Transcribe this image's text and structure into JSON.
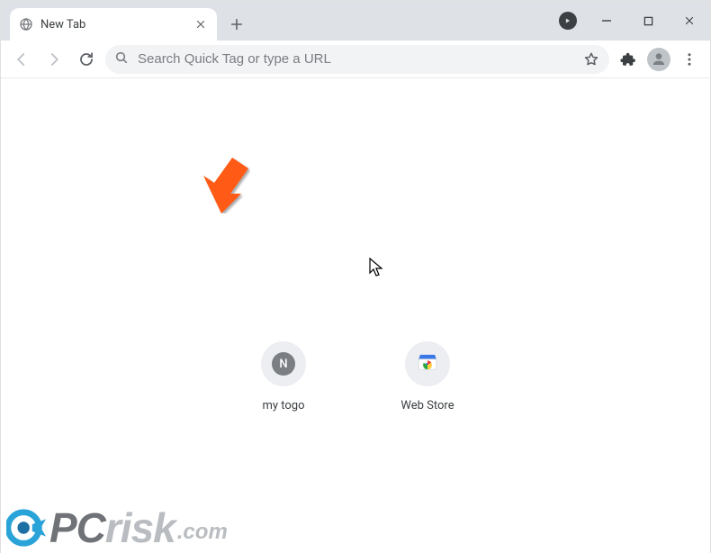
{
  "window": {
    "tab_title": "New Tab"
  },
  "omnibox": {
    "placeholder": "Search Quick Tag or type a URL",
    "value": ""
  },
  "shortcuts": [
    {
      "label": "my togo",
      "letter": "N",
      "kind": "letter"
    },
    {
      "label": "Web Store",
      "kind": "webstore"
    }
  ],
  "watermark": {
    "text_lead": "PC",
    "text_rest": "risk",
    "ext": ".com"
  },
  "icons": {
    "globe": "globe-icon",
    "close": "close-icon",
    "plus": "plus-icon",
    "media": "media-indicator",
    "minimize": "minimize-icon",
    "maximize": "maximize-icon",
    "win_close": "window-close-icon",
    "back": "back-icon",
    "forward": "forward-icon",
    "reload": "reload-icon",
    "search": "search-icon",
    "star": "star-icon",
    "ext": "extensions-icon",
    "profile": "profile-icon",
    "menu": "menu-icon"
  }
}
